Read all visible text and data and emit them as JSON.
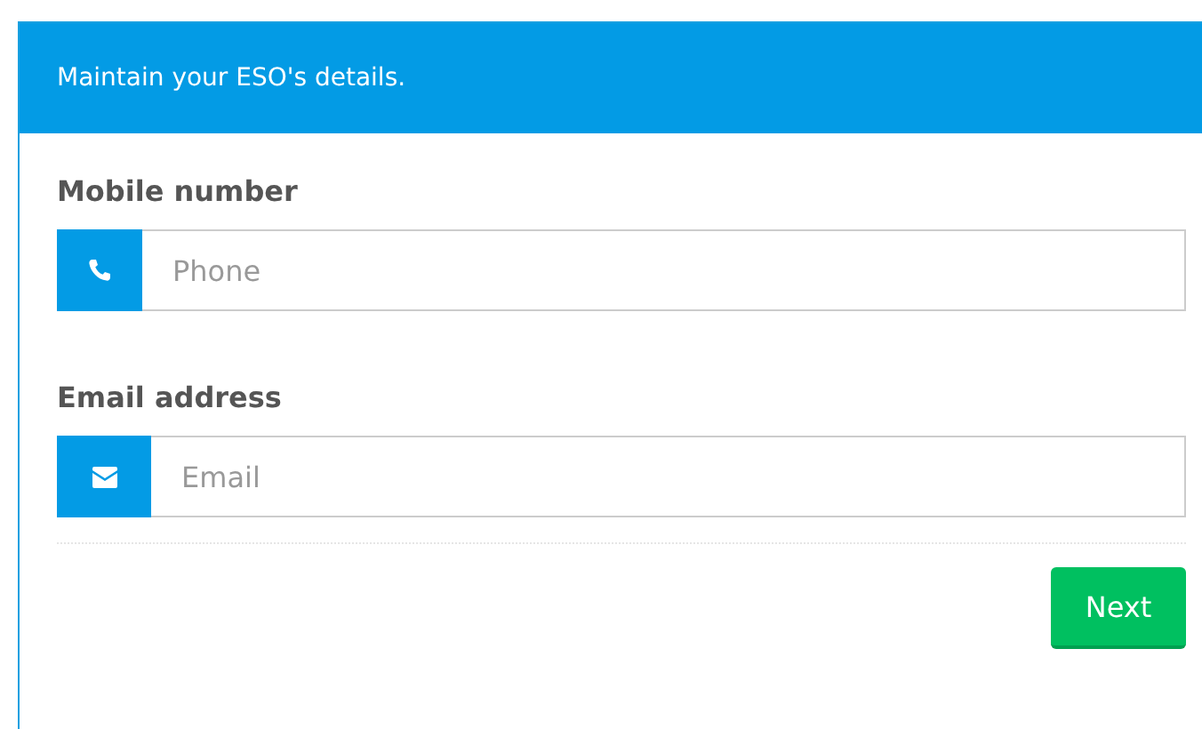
{
  "panel": {
    "heading": "Maintain your ESO's details."
  },
  "fields": [
    {
      "label": "Mobile number",
      "kind": "phone",
      "placeholder": "Phone"
    },
    {
      "label": "Email address",
      "kind": "email",
      "placeholder": "Email"
    }
  ],
  "buttons": [
    {
      "label": "Next"
    }
  ]
}
